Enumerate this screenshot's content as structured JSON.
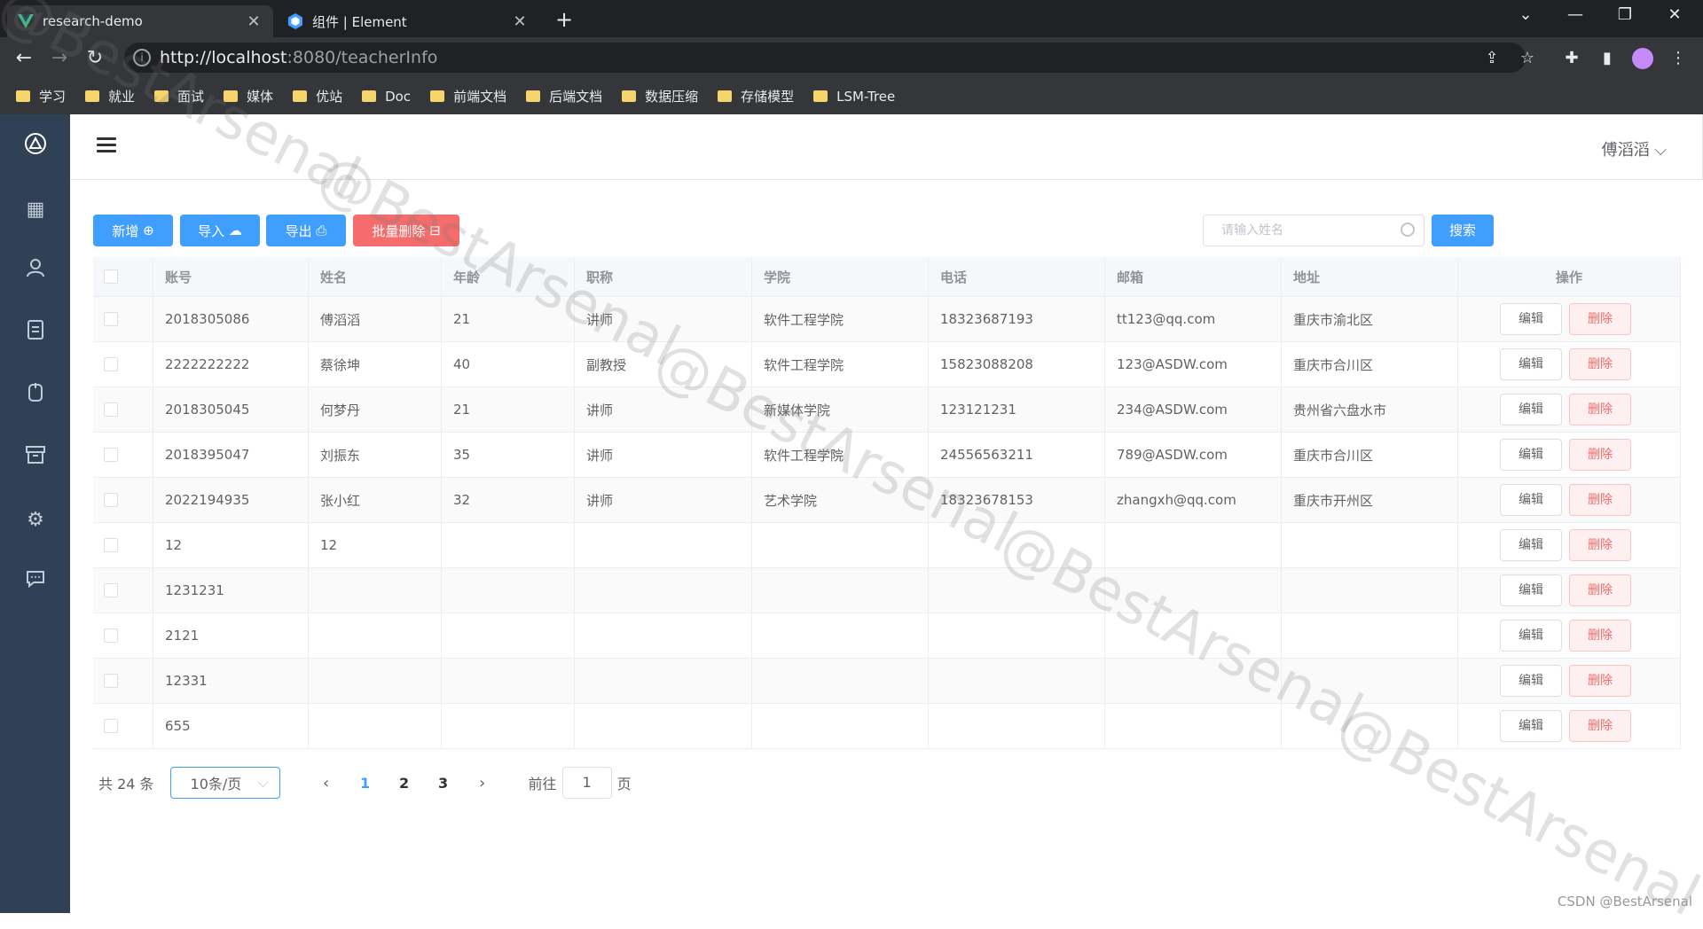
{
  "browser": {
    "tabs": [
      {
        "title": "research-demo",
        "active": true
      },
      {
        "title": "组件 | Element",
        "active": false
      }
    ],
    "url_host": "http://localhost",
    "url_path": ":8080/teacherInfo",
    "bookmarks": [
      "学习",
      "就业",
      "面试",
      "媒体",
      "优站",
      "Doc",
      "前端文档",
      "后端文档",
      "数据压缩",
      "存储模型",
      "LSM-Tree"
    ]
  },
  "sidebar": {
    "icons": [
      "logo-icon",
      "dashboard-icon",
      "user-icon",
      "document-icon",
      "clipboard-icon",
      "archive-icon",
      "settings-icon",
      "message-icon"
    ]
  },
  "header": {
    "username": "傅滔滔"
  },
  "actions": {
    "add": "新增",
    "import": "导入",
    "export": "导出",
    "batch_delete": "批量删除",
    "search_placeholder": "请输入姓名",
    "search": "搜索"
  },
  "table": {
    "headers": [
      "账号",
      "姓名",
      "年龄",
      "职称",
      "学院",
      "电话",
      "邮箱",
      "地址",
      "操作"
    ],
    "edit_label": "编辑",
    "delete_label": "删除",
    "rows": [
      [
        "2018305086",
        "傅滔滔",
        "21",
        "讲师",
        "软件工程学院",
        "18323687193",
        "tt123@qq.com",
        "重庆市渝北区"
      ],
      [
        "2222222222",
        "蔡徐坤",
        "40",
        "副教授",
        "软件工程学院",
        "15823088208",
        "123@ASDW.com",
        "重庆市合川区"
      ],
      [
        "2018305045",
        "何梦丹",
        "21",
        "讲师",
        "新媒体学院",
        "123121231",
        "234@ASDW.com",
        "贵州省六盘水市"
      ],
      [
        "2018395047",
        "刘振东",
        "35",
        "讲师",
        "软件工程学院",
        "24556563211",
        "789@ASDW.com",
        "重庆市合川区"
      ],
      [
        "2022194935",
        "张小红",
        "32",
        "讲师",
        "艺术学院",
        "18323678153",
        "zhangxh@qq.com",
        "重庆市开州区"
      ],
      [
        "12",
        "12",
        "",
        "",
        "",
        "",
        "",
        ""
      ],
      [
        "1231231",
        "",
        "",
        "",
        "",
        "",
        "",
        ""
      ],
      [
        "2121",
        "",
        "",
        "",
        "",
        "",
        "",
        ""
      ],
      [
        "12331",
        "",
        "",
        "",
        "",
        "",
        "",
        ""
      ],
      [
        "655",
        "",
        "",
        "",
        "",
        "",
        "",
        ""
      ]
    ]
  },
  "pagination": {
    "total": "共 24 条",
    "page_size": "10条/页",
    "pages": [
      "1",
      "2",
      "3"
    ],
    "current": "1",
    "goto_prefix": "前往",
    "goto_value": "1",
    "goto_suffix": "页"
  },
  "watermark": "@BestArsenal",
  "footer_credit": "CSDN @BestArsenal",
  "colors": {
    "primary": "#409eff",
    "danger": "#f56c6c",
    "sidebar": "#304156"
  }
}
